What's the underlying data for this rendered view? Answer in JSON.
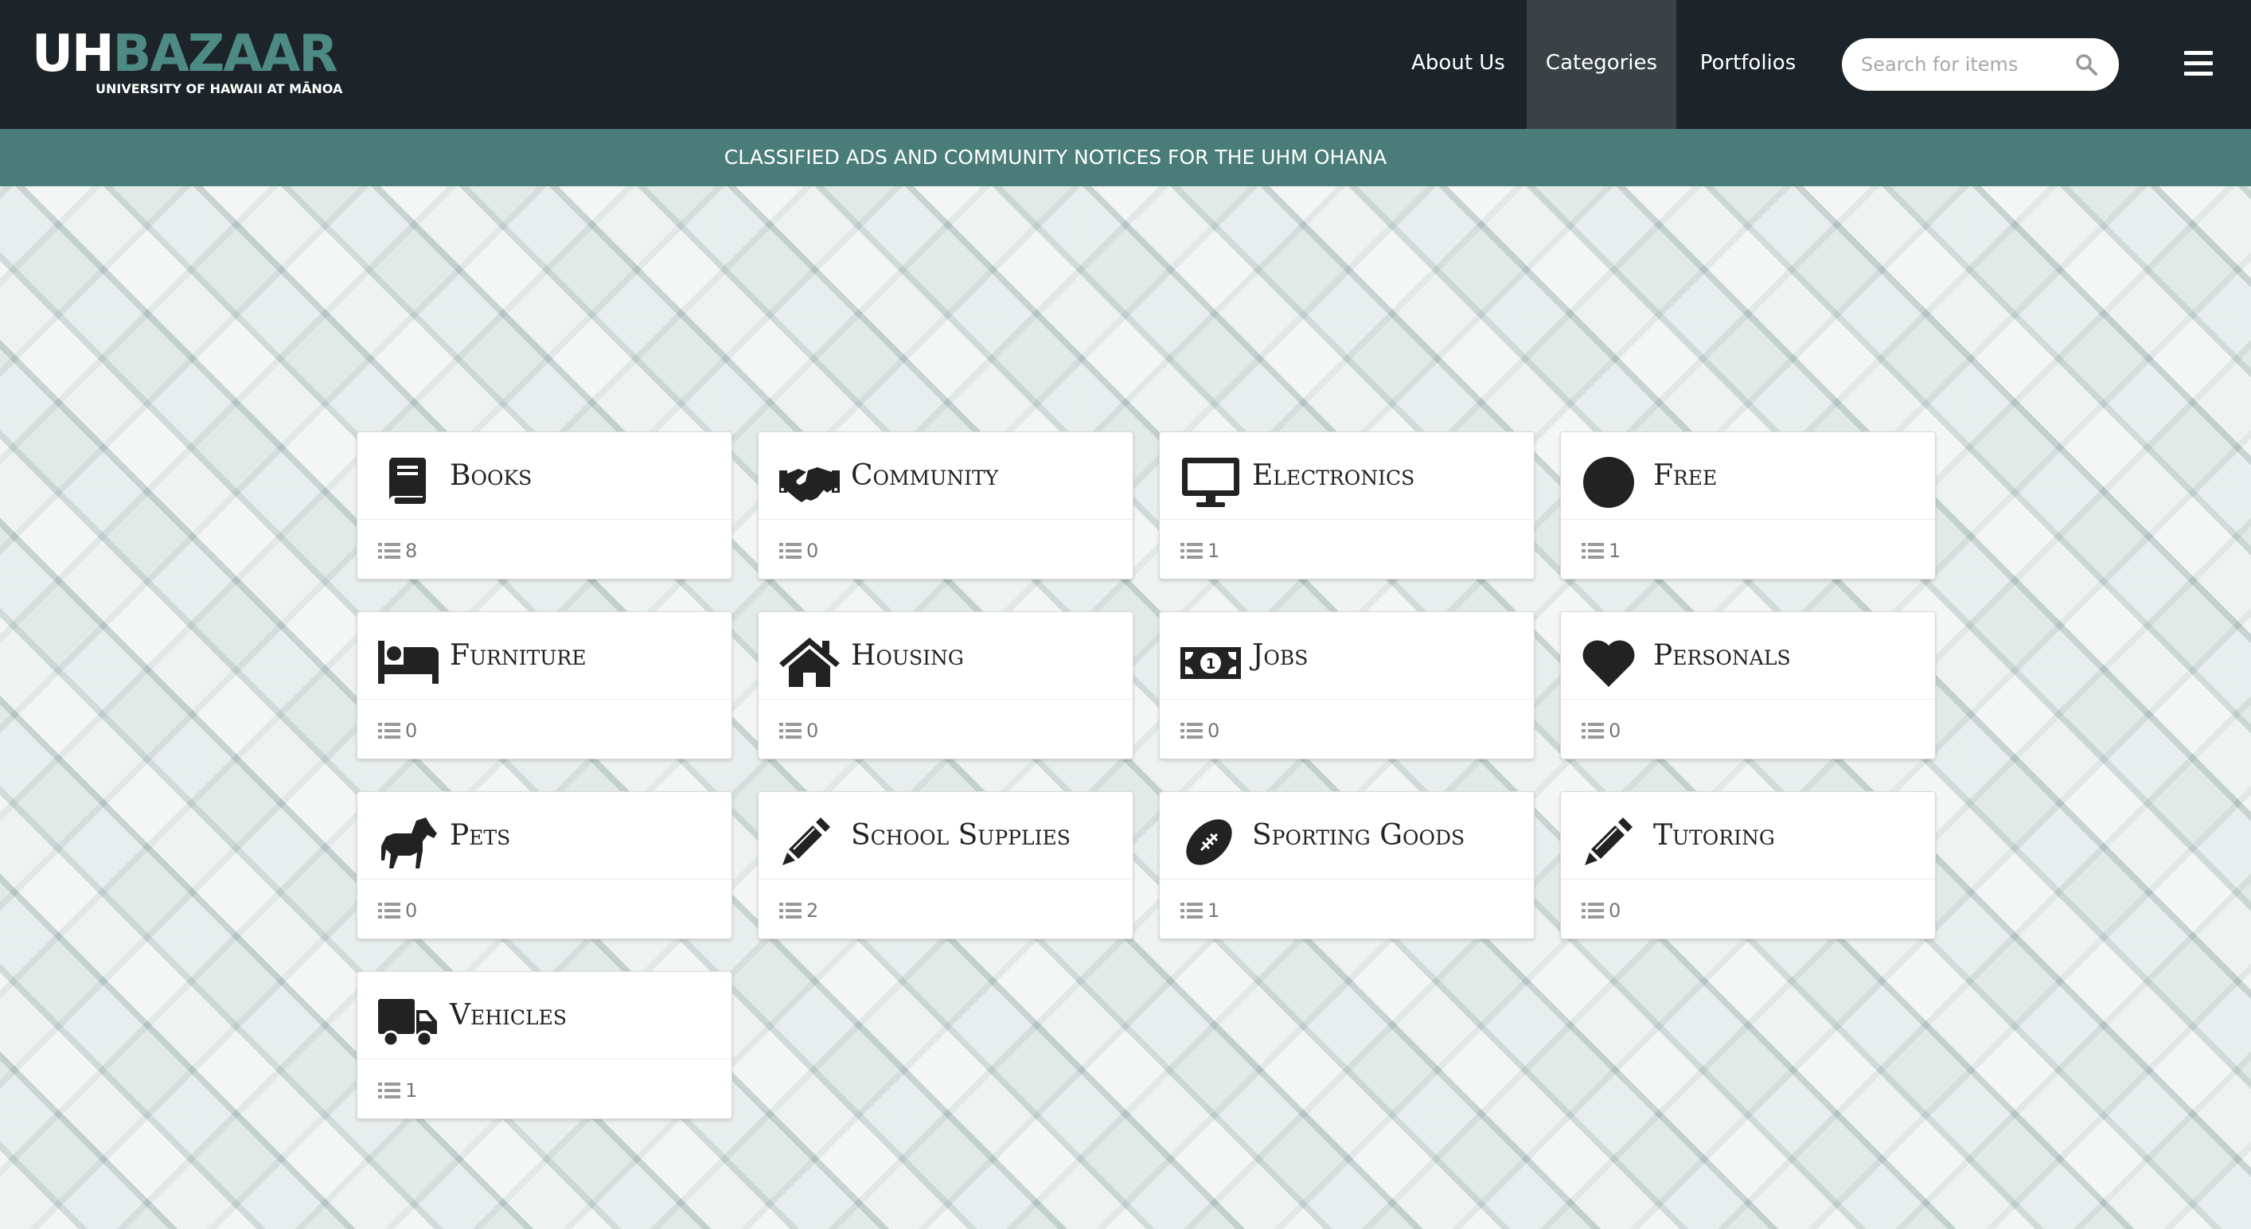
{
  "header": {
    "logo_main_1": "UH",
    "logo_main_2": "BAZAAR",
    "logo_sub": "UNIVERSITY OF HAWAII AT MĀNOA",
    "nav": {
      "about": "About Us",
      "categories": "Categories",
      "portfolios": "Portfolios"
    },
    "search": {
      "placeholder": "Search for items",
      "value": ""
    }
  },
  "banner": {
    "text": "CLASSIFIED ADS AND COMMUNITY NOTICES FOR THE UHM OHANA"
  },
  "categories": [
    {
      "name": "Books",
      "count": "8",
      "icon": "book-icon"
    },
    {
      "name": "Community",
      "count": "0",
      "icon": "handshake-icon"
    },
    {
      "name": "Electronics",
      "count": "1",
      "icon": "monitor-icon"
    },
    {
      "name": "Free",
      "count": "1",
      "icon": "circle-icon"
    },
    {
      "name": "Furniture",
      "count": "0",
      "icon": "bed-icon"
    },
    {
      "name": "Housing",
      "count": "0",
      "icon": "home-icon"
    },
    {
      "name": "Jobs",
      "count": "0",
      "icon": "money-icon"
    },
    {
      "name": "Personals",
      "count": "0",
      "icon": "heart-icon"
    },
    {
      "name": "Pets",
      "count": "0",
      "icon": "horse-icon"
    },
    {
      "name": "School Supplies",
      "count": "2",
      "icon": "pencil-icon"
    },
    {
      "name": "Sporting Goods",
      "count": "1",
      "icon": "football-icon"
    },
    {
      "name": "Tutoring",
      "count": "0",
      "icon": "pencil-icon"
    },
    {
      "name": "Vehicles",
      "count": "1",
      "icon": "truck-icon"
    }
  ],
  "colors": {
    "navbar": "#1c2429",
    "brand": "#4d8a84",
    "banner": "#4a7d79"
  }
}
